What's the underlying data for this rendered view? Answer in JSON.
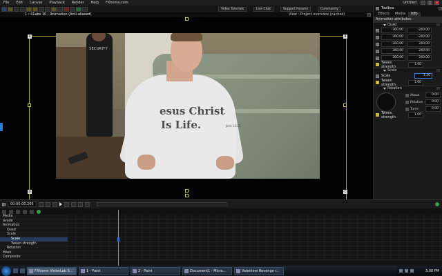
{
  "menubar": {
    "items": [
      "File",
      "Edit",
      "Canvas",
      "Playback",
      "Render",
      "Help",
      "FXhome.com"
    ],
    "doc_title": "Untitled"
  },
  "toplinks": [
    "Video Tutorials",
    "Live Chat",
    "Support Forums",
    "Community"
  ],
  "viewer": {
    "title": "1 : 41abs 10 : Animation (Anti-aliased)",
    "view": "View : Project overview (cached)"
  },
  "video": {
    "shirt_line1": "esus Christ",
    "shirt_line2": "Is Life.",
    "shirt_ref": "John 11:25",
    "guard_text": "SECURITY"
  },
  "panel": {
    "title": "Toolbox",
    "tabs": [
      "Effects",
      "Media",
      "Info"
    ],
    "active_tab": "Info",
    "subheader": "Animation attributes",
    "quad": {
      "label": "Quad",
      "rows": [
        [
          "-360.00",
          "-240.00"
        ],
        [
          "360.00",
          "-240.00"
        ],
        [
          "-360.00",
          "240.00"
        ],
        [
          "360.00",
          "240.00"
        ],
        [
          "360.00",
          "240.00"
        ]
      ],
      "tween_label": "Tween strength",
      "tween_value": "1.00"
    },
    "scale": {
      "label": "Scale",
      "row_label": "Scale",
      "value": "1.20",
      "tween_label": "Tween strength",
      "tween_value": "1.00"
    },
    "rotation": {
      "label": "Rotation",
      "about_label": "About",
      "about_value": "0.00",
      "relative_label": "Relative",
      "relative_value": "0.00",
      "turns_label": "Turns",
      "turns_value": "0.00",
      "tween_label": "Tween strength",
      "tween_value": "1.00"
    }
  },
  "timeline": {
    "timecode": "00:00:00.266",
    "rows": [
      "Media",
      "Grade",
      "Animation",
      "Quad",
      "Scale",
      "Scale",
      "Tween strength",
      "Rotation",
      "Mask",
      "Composite"
    ]
  },
  "taskbar": {
    "tasks": [
      "FXhome VisionLab S...",
      "1 - Paint",
      "2 - Paint",
      "Document1 - Micro...",
      "Valentine Revenge r..."
    ],
    "clock": "3:00 PM"
  }
}
